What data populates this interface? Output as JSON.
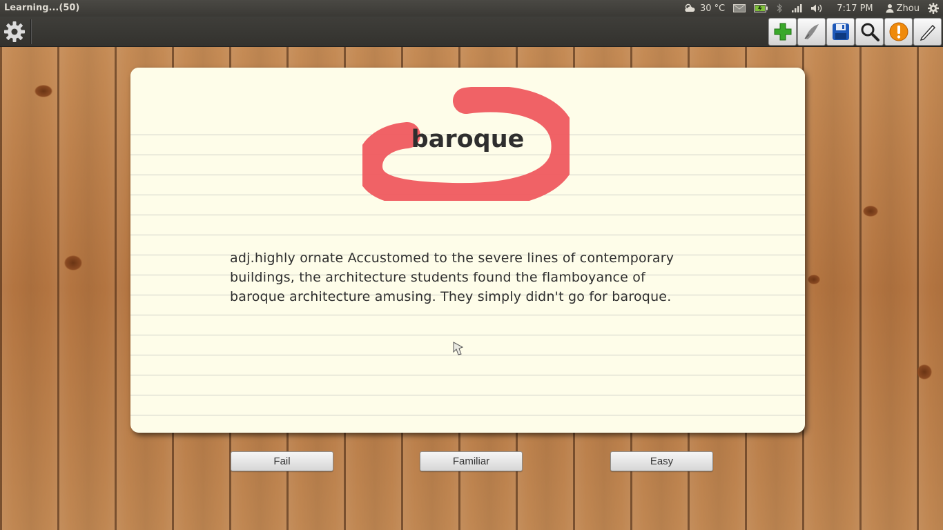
{
  "window": {
    "title": "Learning...(50)"
  },
  "panel": {
    "weather": "30 °C",
    "time": "7:17 PM",
    "user": "Zhou",
    "icons": [
      "weather-icon",
      "mail-icon",
      "battery-icon",
      "bluetooth-icon",
      "network-signal-icon",
      "volume-icon",
      "user-icon",
      "system-gear-icon"
    ]
  },
  "toolbar": {
    "buttons": [
      {
        "name": "add-icon",
        "color": "#3aa82a"
      },
      {
        "name": "edit-sketch-icon",
        "color": "#777777"
      },
      {
        "name": "save-icon",
        "color": "#1d58b8"
      },
      {
        "name": "search-icon",
        "color": "#222222"
      },
      {
        "name": "alert-icon",
        "color": "#ef8a0b"
      },
      {
        "name": "pencil-icon",
        "color": "#333333"
      }
    ]
  },
  "card": {
    "word": "baroque",
    "definition": " adj.highly ornate Accustomed to the severe lines of contemporary buildings, the architecture students found the flamboyance of baroque architecture amusing. They simply didn't go for baroque.",
    "highlight_color": "#ef5a5f"
  },
  "answers": {
    "fail": "Fail",
    "familiar": "Familiar",
    "easy": "Easy"
  }
}
